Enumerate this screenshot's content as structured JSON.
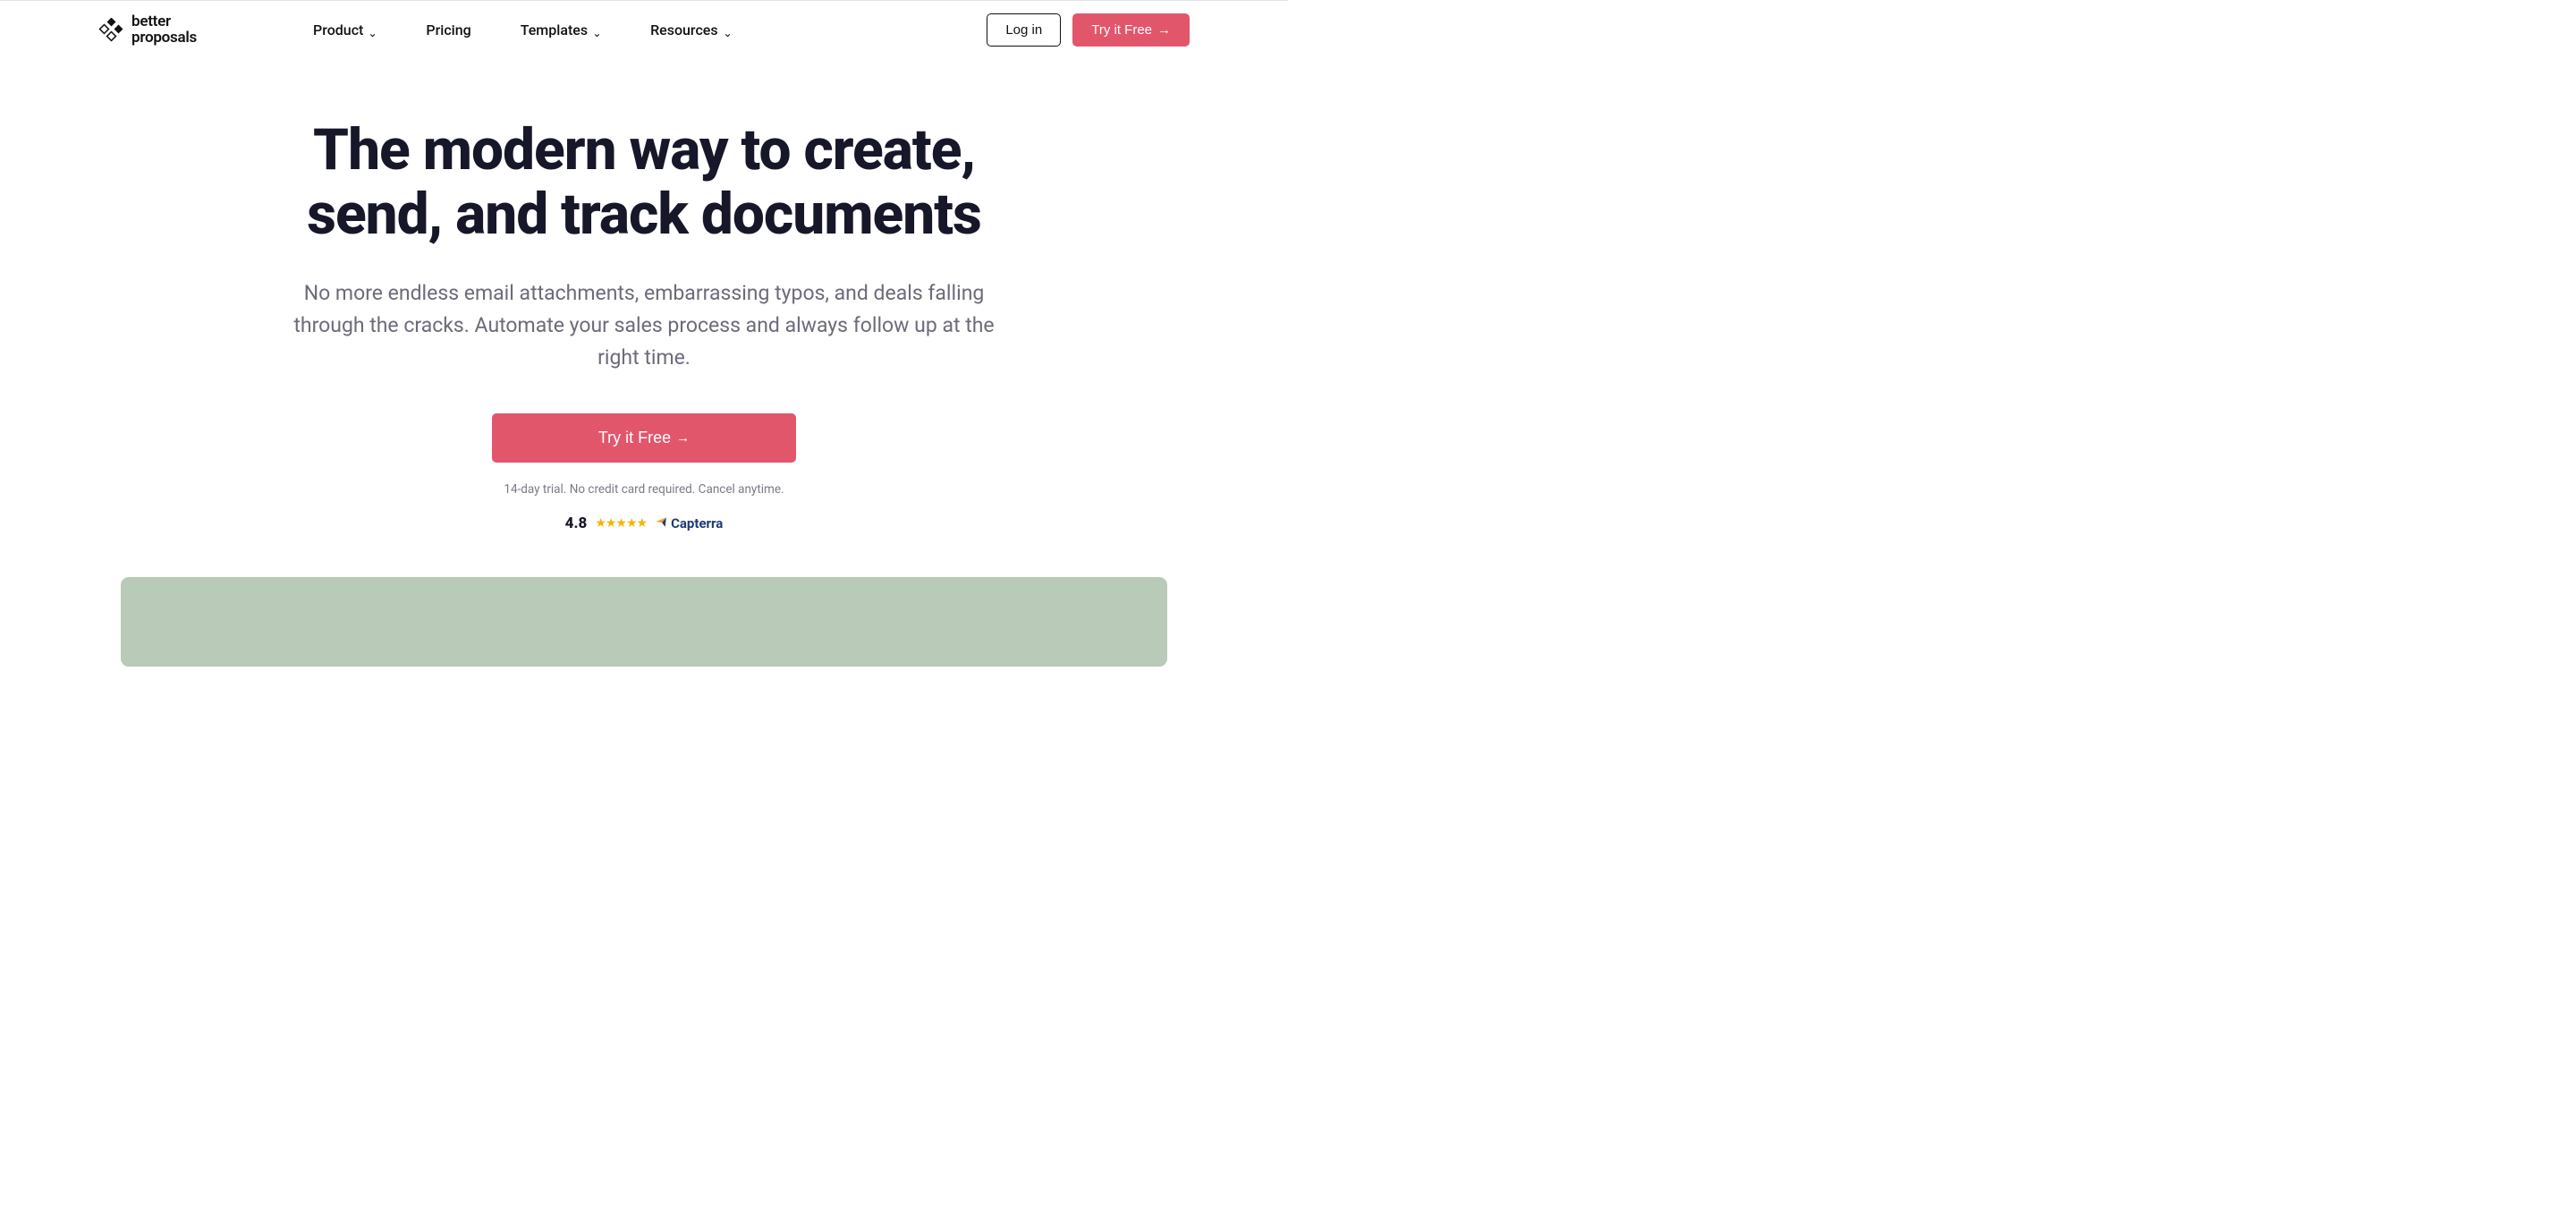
{
  "brand": {
    "line1": "better",
    "line2": "proposals"
  },
  "nav": {
    "items": [
      {
        "label": "Product",
        "dropdown": true
      },
      {
        "label": "Pricing",
        "dropdown": false
      },
      {
        "label": "Templates",
        "dropdown": true
      },
      {
        "label": "Resources",
        "dropdown": true
      }
    ],
    "login": "Log in",
    "cta": "Try it Free"
  },
  "hero": {
    "headline": "The modern way to create, send, and track documents",
    "sub": "No more endless email attachments, embarrassing typos, and deals falling through the cracks. Automate your sales process and always follow up at the right time.",
    "cta": "Try it Free",
    "fineprint": "14-day trial. No credit card required. Cancel anytime."
  },
  "rating": {
    "score": "4.8",
    "stars": 5,
    "source": "Capterra"
  },
  "colors": {
    "primary": "#e2566c",
    "text": "#17172a",
    "muted": "#6b6b7a",
    "band": "#b9cab8"
  }
}
